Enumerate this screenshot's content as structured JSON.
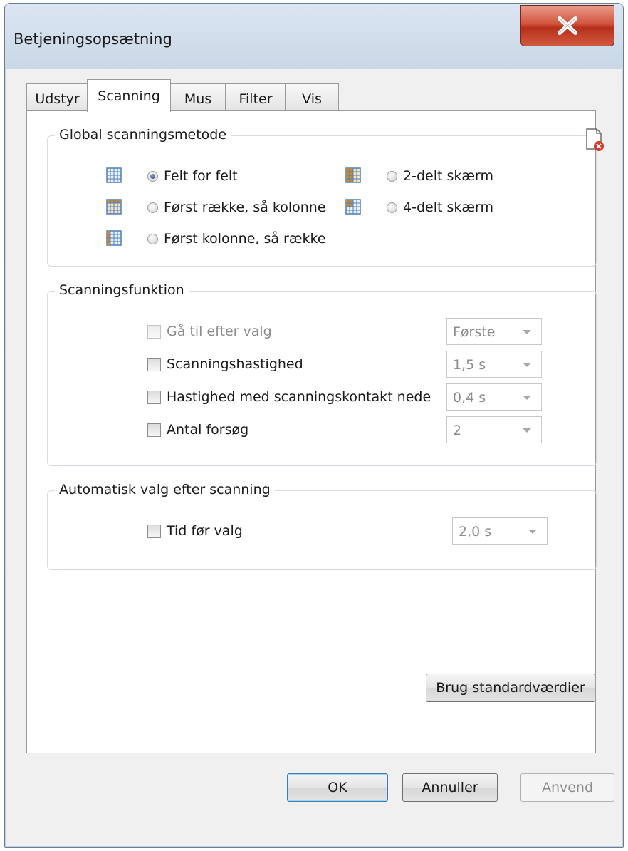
{
  "window": {
    "title": "Betjeningsopsætning"
  },
  "tabs": [
    {
      "label": "Udstyr",
      "active": false
    },
    {
      "label": "Scanning",
      "active": true
    },
    {
      "label": "Mus",
      "active": false
    },
    {
      "label": "Filter",
      "active": false
    },
    {
      "label": "Vis",
      "active": false
    }
  ],
  "global_method": {
    "title": "Global scanningsmetode",
    "options": [
      {
        "label": "Felt for felt",
        "checked": true
      },
      {
        "label": "Først række, så kolonne",
        "checked": false
      },
      {
        "label": "Først kolonne, så række",
        "checked": false
      },
      {
        "label": "2-delt skærm",
        "checked": false
      },
      {
        "label": "4-delt skærm",
        "checked": false
      }
    ]
  },
  "scan_function": {
    "title": "Scanningsfunktion",
    "rows": [
      {
        "label": "Gå til efter valg",
        "value": "Første",
        "enabled": false
      },
      {
        "label": "Scanningshastighed",
        "value": "1,5 s",
        "enabled": true
      },
      {
        "label": "Hastighed med scanningskontakt nede",
        "value": "0,4 s",
        "enabled": true
      },
      {
        "label": "Antal forsøg",
        "value": "2",
        "enabled": true
      }
    ]
  },
  "auto_select": {
    "title": "Automatisk valg efter scanning",
    "label": "Tid før valg",
    "value": "2,0 s"
  },
  "buttons": {
    "defaults": "Brug standardværdier",
    "ok": "OK",
    "cancel": "Annuller",
    "apply": "Anvend"
  },
  "colors": {
    "accent": "#3c7fb1",
    "close": "#c7432b",
    "grid_icon_blue": "#4f7fb8",
    "grid_icon_brown": "#c08a3e"
  }
}
